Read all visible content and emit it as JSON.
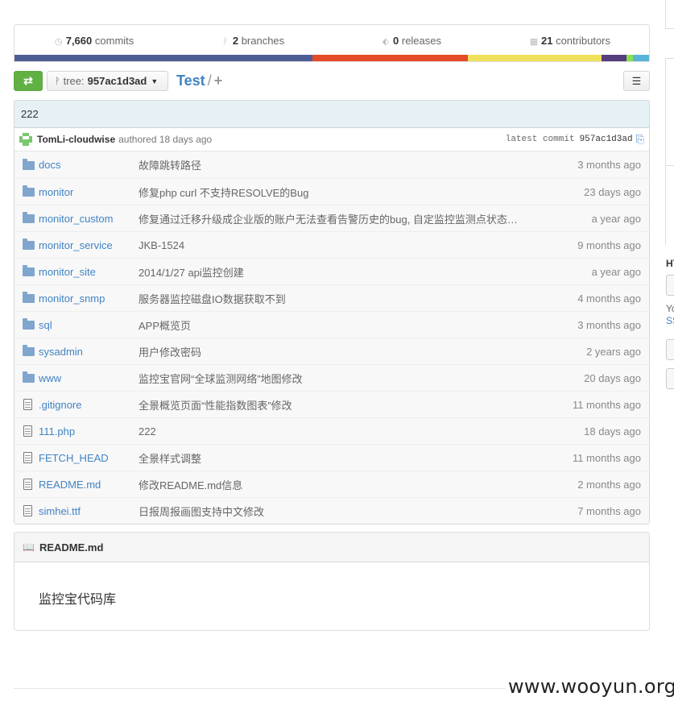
{
  "stats": {
    "commits": {
      "num": "7,660",
      "label": "commits",
      "icon": "history-icon"
    },
    "branches": {
      "num": "2",
      "label": "branches",
      "icon": "branch-icon"
    },
    "releases": {
      "num": "0",
      "label": "releases",
      "icon": "tag-icon"
    },
    "contributors": {
      "num": "21",
      "label": "contributors",
      "icon": "organization-icon"
    }
  },
  "language_bar": {
    "segments": [
      {
        "share": 0.47,
        "color": "#4f5d95"
      },
      {
        "share": 0.245,
        "color": "#e34c26"
      },
      {
        "share": 0.21,
        "color": "#f1e05a"
      },
      {
        "share": 0.04,
        "color": "#563d7c"
      },
      {
        "share": 0.01,
        "color": "#89e051"
      },
      {
        "share": 0.025,
        "color": "#5ab3d9"
      }
    ]
  },
  "file_nav": {
    "branch_label": "tree:",
    "branch_value": "957ac1d3ad",
    "repo_name": "Test",
    "separator": "/",
    "add": "+"
  },
  "commit": {
    "message": "222",
    "author": "TomLi-cloudwise",
    "authored": "authored 18 days ago",
    "latest_label": "latest commit",
    "sha": "957ac1d3ad"
  },
  "files": [
    {
      "type": "folder",
      "name": "docs",
      "message": "故障跳转路径",
      "age": "3 months ago"
    },
    {
      "type": "folder",
      "name": "monitor",
      "message": "修复php curl 不支持RESOLVE的Bug",
      "age": "23 days ago"
    },
    {
      "type": "folder",
      "name": "monitor_custom",
      "message": "修复通过迁移升级成企业版的账户无法查看告警历史的bug, 自定监控监测点状态页url处…",
      "age": "a year ago"
    },
    {
      "type": "folder",
      "name": "monitor_service",
      "message": "JKB-1524",
      "age": "9 months ago"
    },
    {
      "type": "folder",
      "name": "monitor_site",
      "message": "2014/1/27 api监控创建",
      "age": "a year ago"
    },
    {
      "type": "folder",
      "name": "monitor_snmp",
      "message": "服务器监控磁盘IO数据获取不到",
      "age": "4 months ago"
    },
    {
      "type": "folder",
      "name": "sql",
      "message": "APP概览页",
      "age": "3 months ago"
    },
    {
      "type": "folder",
      "name": "sysadmin",
      "message": "用户修改密码",
      "age": "2 years ago"
    },
    {
      "type": "folder",
      "name": "www",
      "message": "监控宝官网“全球监测网络”地图修改",
      "age": "20 days ago"
    },
    {
      "type": "file",
      "name": ".gitignore",
      "message": "全景概览页面“性能指数图表”修改",
      "age": "11 months ago"
    },
    {
      "type": "file",
      "name": "111.php",
      "message": "222",
      "age": "18 days ago"
    },
    {
      "type": "file",
      "name": "FETCH_HEAD",
      "message": "全景样式调整",
      "age": "11 months ago"
    },
    {
      "type": "file",
      "name": "README.md",
      "message": "修改README.md信息",
      "age": "2 months ago"
    },
    {
      "type": "file",
      "name": "simhei.ttf",
      "message": "日报周报画图支持中文修改",
      "age": "7 months ago"
    }
  ],
  "readme": {
    "title": "README.md",
    "content": "监控宝代码库"
  },
  "side": {
    "label1": "HTTPS",
    "label2": "You",
    "link": "SSH"
  },
  "watermark": "www.wooyun.org"
}
